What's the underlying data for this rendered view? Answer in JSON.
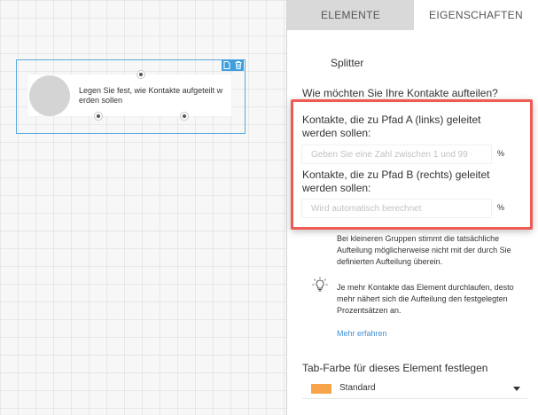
{
  "tabs": {
    "elements": "ELEMENTE",
    "properties": "EIGENSCHAFTEN"
  },
  "node": {
    "text": "Legen Sie fest, wie Kontakte aufgeteilt werden sollen",
    "toolbar_icons": [
      "copy-icon",
      "trash-icon"
    ]
  },
  "panel": {
    "title": "Splitter",
    "question": "Wie möchten Sie Ihre Kontakte aufteilen?",
    "path_a_label": "Kontakte, die zu Pfad A (links) geleitet werden sollen:",
    "path_a_placeholder": "Geben Sie eine Zahl zwischen 1 und 99",
    "path_a_unit": "%",
    "path_b_label": "Kontakte, die zu Pfad B (rechts) geleitet werden sollen:",
    "path_b_placeholder": "Wird automatisch berechnet",
    "path_b_unit": "%",
    "info_1": "Bei kleineren Gruppen stimmt die tatsächliche Aufteilung möglicherweise nicht mit der durch Sie definierten Aufteilung überein.",
    "info_2": "Je mehr Kontakte das Element durchlaufen, desto mehr nähert sich die Aufteilung den festgelegten Prozentsätzen an.",
    "info_icon": "lightbulb-icon",
    "more_link": "Mehr erfahren",
    "tab_color_label": "Tab-Farbe für dieses Element festlegen",
    "tab_color_value": "Standard",
    "tab_color_swatch": "#f7a44a"
  },
  "colors": {
    "accent_blue": "#3f9fdc",
    "highlight_red": "#ee5b55"
  }
}
